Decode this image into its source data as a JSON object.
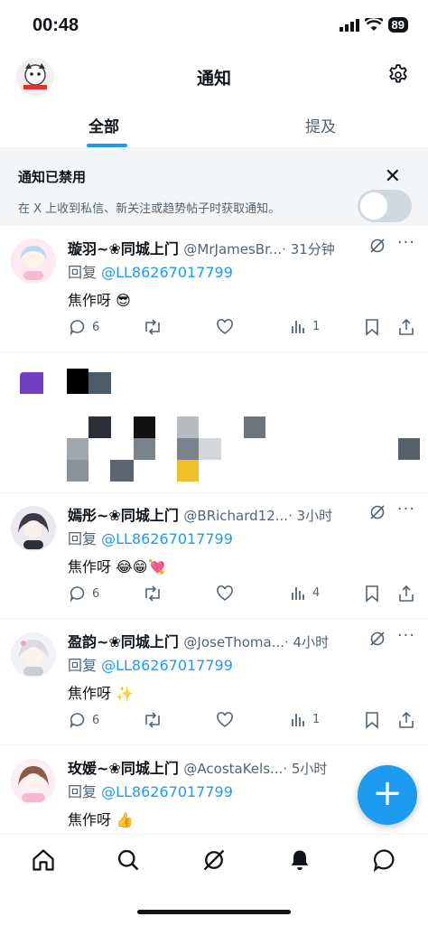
{
  "status": {
    "time": "00:48",
    "battery": "89"
  },
  "header": {
    "title": "通知"
  },
  "tabs": [
    {
      "label": "全部"
    },
    {
      "label": "提及"
    }
  ],
  "banner": {
    "title": "通知已禁用",
    "text": "在 X 上收到私信、新关注或趋势帖子时获取通知。"
  },
  "posts": [
    {
      "name": "璇羽~❀同城上门",
      "handle": "@MrJamesBr...",
      "time": "· 31分钟",
      "reply_prefix": "回复 ",
      "reply_to": "@LL86267017799",
      "text": "焦作呀 😎",
      "replies": "6",
      "views": "1"
    },
    {
      "name": "嫣彤~❀同城上门",
      "handle": "@BRichard12...",
      "time": "· 3小时",
      "reply_prefix": "回复 ",
      "reply_to": "@LL86267017799",
      "text": "焦作呀 😂😁💘",
      "replies": "6",
      "views": "4"
    },
    {
      "name": "盈韵~❀同城上门",
      "handle": "@JoseThoma...",
      "time": "· 4小时",
      "reply_prefix": "回复 ",
      "reply_to": "@LL86267017799",
      "text": "焦作呀 ✨",
      "replies": "6",
      "views": "1"
    },
    {
      "name": "玫媛~❀同城上门",
      "handle": "@AcostaKels...",
      "time": "· 5小时",
      "reply_prefix": "回复 ",
      "reply_to": "@LL86267017799",
      "text": "焦作呀 👍"
    }
  ],
  "icons": {
    "settings": "gear-icon",
    "close": "close-icon",
    "reply": "reply-icon",
    "repost": "repost-icon",
    "like": "heart-icon",
    "views": "views-icon",
    "bookmark": "bookmark-icon",
    "share": "share-icon",
    "compose": "plus-icon"
  },
  "colors": {
    "accent": "#1d9bf0",
    "text": "#0f1419",
    "secondary": "#536471",
    "banner_bg": "#f3f5f6"
  }
}
